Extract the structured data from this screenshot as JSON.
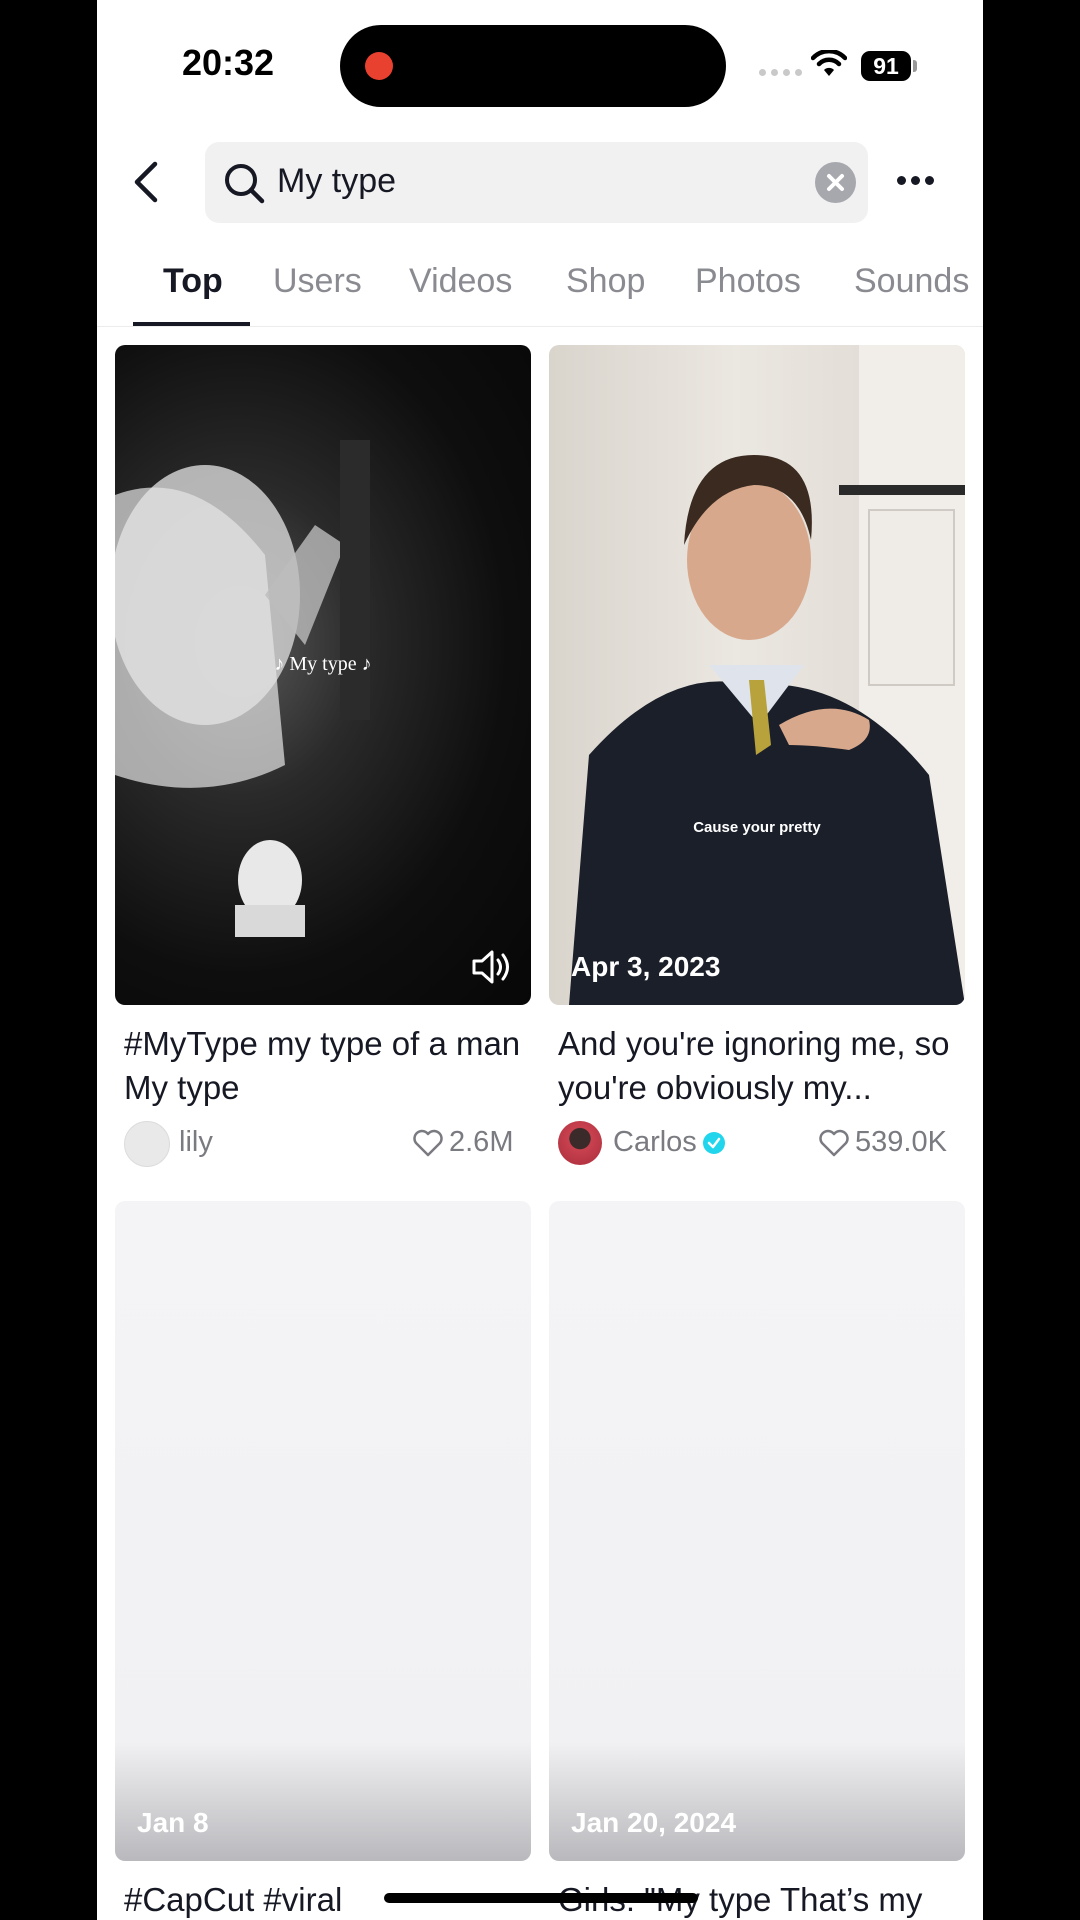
{
  "status_bar": {
    "time": "20:32",
    "battery": "91"
  },
  "search": {
    "query": "My type"
  },
  "tabs": [
    {
      "label": "Top",
      "active": true
    },
    {
      "label": "Users",
      "active": false
    },
    {
      "label": "Videos",
      "active": false
    },
    {
      "label": "Shop",
      "active": false
    },
    {
      "label": "Photos",
      "active": false
    },
    {
      "label": "Sounds",
      "active": false
    }
  ],
  "results": [
    {
      "overlay_text": "♪  My type  ♪",
      "date": "",
      "title": "#MyType my type of a man My type",
      "author": "lily",
      "verified": false,
      "likes": "2.6M"
    },
    {
      "overlay_text": "Cause your pretty",
      "date": "Apr 3, 2023",
      "title": "And you're ignoring me, so you're obviously my...",
      "author": "Carlos",
      "verified": true,
      "likes": "539.0K"
    },
    {
      "overlay_text": "",
      "date": "Jan 8",
      "title": "#CapCut #viral",
      "author": "",
      "verified": false,
      "likes": ""
    },
    {
      "overlay_text": "",
      "date": "Jan 20, 2024",
      "title": "Girls: \"My type That’s my",
      "author": "",
      "verified": false,
      "likes": ""
    }
  ],
  "colors": {
    "accent_text": "#161823",
    "secondary_text": "#8a8b91",
    "verified": "#20d5ec",
    "record_dot": "#e9412f"
  },
  "icons": [
    "back-arrow-icon",
    "search-icon",
    "clear-icon",
    "more-icon",
    "sound-on-icon",
    "heart-icon",
    "verified-icon",
    "wifi-icon"
  ]
}
